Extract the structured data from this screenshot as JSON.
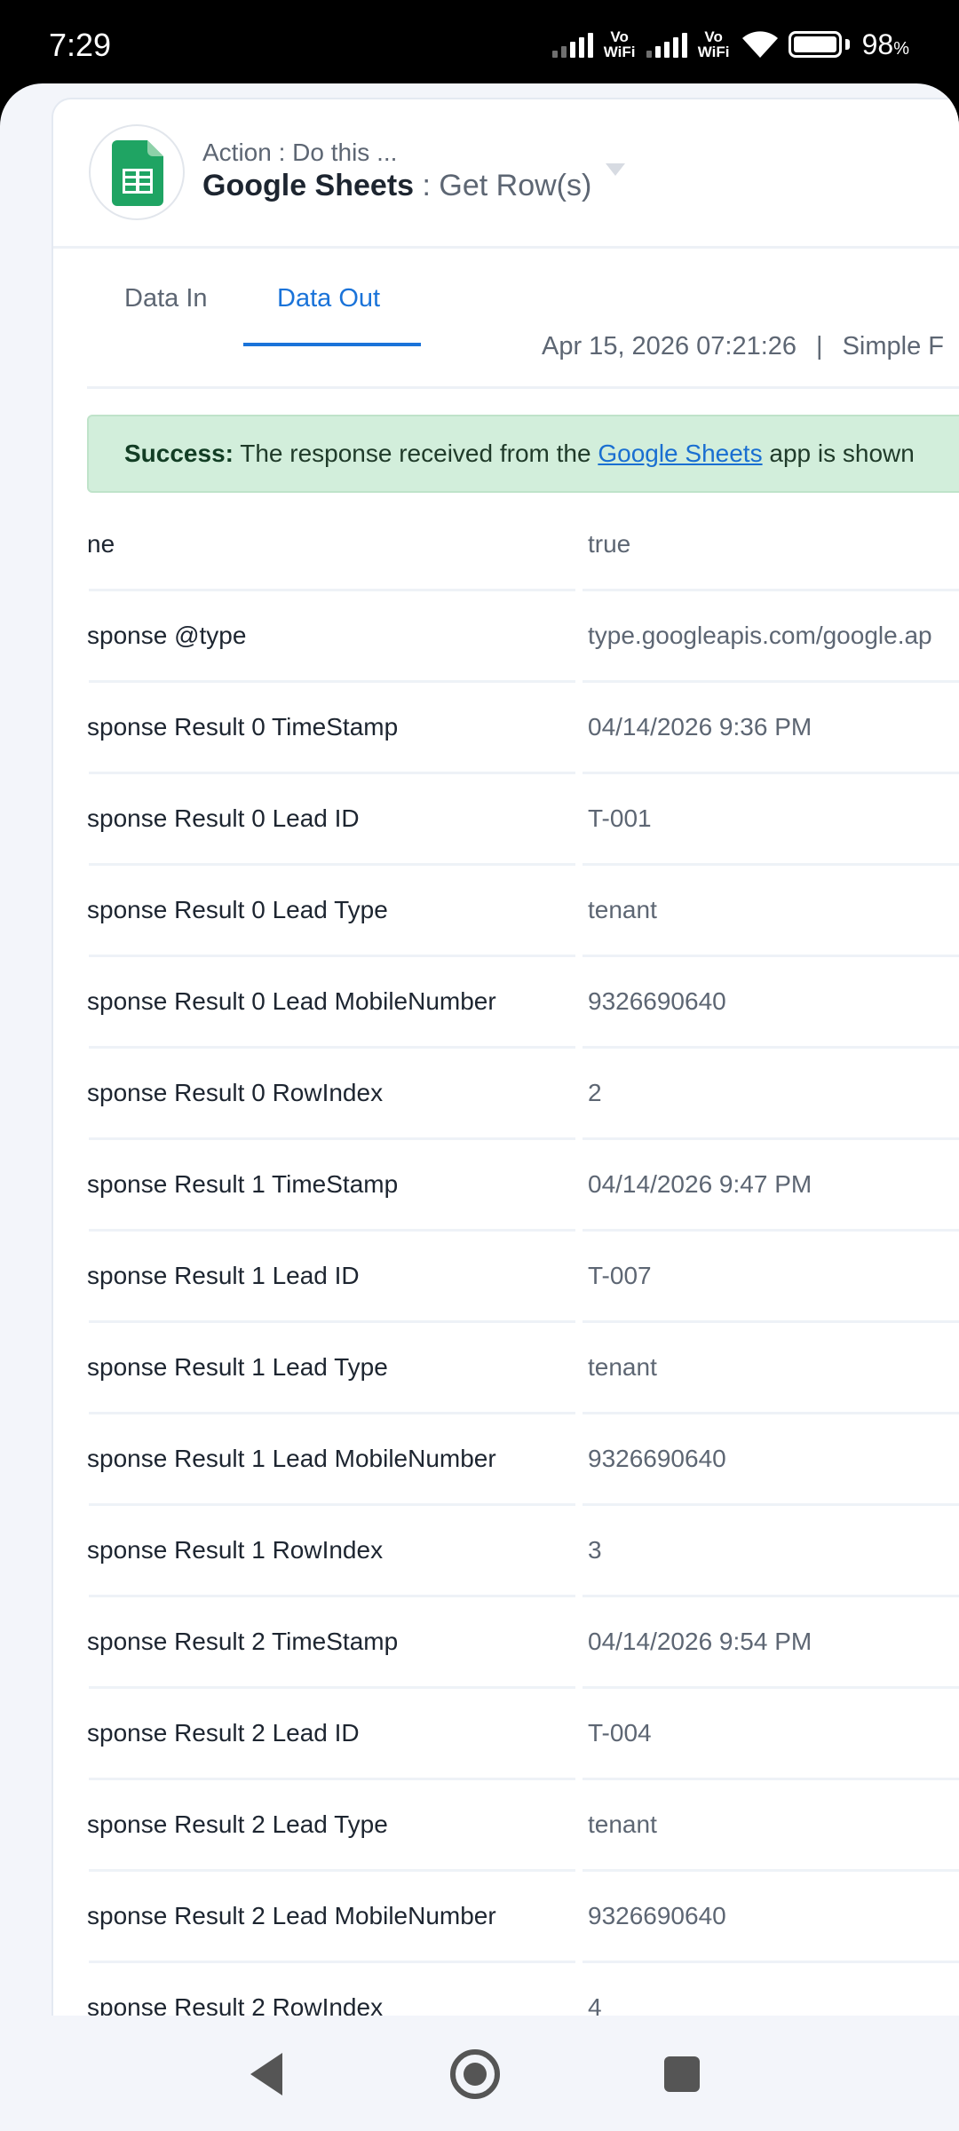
{
  "status_bar": {
    "time": "7:29",
    "network_1": "Vo WiFi",
    "network_2": "Vo WiFi",
    "battery_percent": "98",
    "battery_unit": "%"
  },
  "header": {
    "action_label": "Action : Do this ...",
    "app_name": "Google Sheets",
    "separator": " : ",
    "operation": "Get Row(s)"
  },
  "tabs": {
    "data_in": "Data In",
    "data_out": "Data Out"
  },
  "meta": {
    "timestamp": "Apr 15, 2026 07:21:26",
    "separator": "|",
    "view": "Simple F"
  },
  "banner": {
    "label": "Success:",
    "text_before": " The response received from the ",
    "link": "Google Sheets",
    "text_after": " app is shown"
  },
  "rows": [
    {
      "key": "ne",
      "value": "true"
    },
    {
      "key": "sponse @type",
      "value": "type.googleapis.com/google.ap"
    },
    {
      "key": "sponse Result 0 TimeStamp",
      "value": "04/14/2026 9:36 PM"
    },
    {
      "key": "sponse Result 0 Lead ID",
      "value": "T-001"
    },
    {
      "key": "sponse Result 0 Lead Type",
      "value": "tenant"
    },
    {
      "key": "sponse Result 0 Lead MobileNumber",
      "value": "9326690640"
    },
    {
      "key": "sponse Result 0 RowIndex",
      "value": "2"
    },
    {
      "key": "sponse Result 1 TimeStamp",
      "value": "04/14/2026 9:47 PM"
    },
    {
      "key": "sponse Result 1 Lead ID",
      "value": "T-007"
    },
    {
      "key": "sponse Result 1 Lead Type",
      "value": "tenant"
    },
    {
      "key": "sponse Result 1 Lead MobileNumber",
      "value": "9326690640"
    },
    {
      "key": "sponse Result 1 RowIndex",
      "value": "3"
    },
    {
      "key": "sponse Result 2 TimeStamp",
      "value": "04/14/2026 9:54 PM"
    },
    {
      "key": "sponse Result 2 Lead ID",
      "value": "T-004"
    },
    {
      "key": "sponse Result 2 Lead Type",
      "value": "tenant"
    },
    {
      "key": "sponse Result 2 Lead MobileNumber",
      "value": "9326690640"
    },
    {
      "key": "sponse Result 2 RowIndex",
      "value": "4"
    }
  ],
  "icons": {
    "app_logo": "google-sheets-icon",
    "nav_back": "back-triangle-icon",
    "nav_home": "home-circle-icon",
    "nav_recent": "recent-apps-square-icon"
  },
  "colors": {
    "accent": "#1a73d9",
    "success_bg": "#d2eedb",
    "sheets_green": "#1fa463"
  }
}
